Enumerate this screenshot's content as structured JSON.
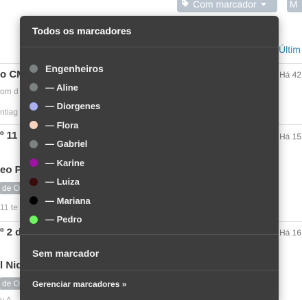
{
  "toolbar": {
    "filter_button_label": "Com marcador",
    "next_button_partial": "M"
  },
  "background": {
    "column_header": "Últim",
    "rows": [
      {
        "title": "o CM",
        "sub1": "om d",
        "sub2": "ntiag",
        "time": "Há 42"
      },
      {
        "title": "º 11",
        "time": "Há 15"
      },
      {
        "title": "eo P",
        "tag": "de O",
        "sub": "11 te"
      },
      {
        "title": "º 2 d",
        "time": "Há 16"
      },
      {
        "title": "l Niq",
        "tag": "de O",
        "sub": "y A"
      }
    ]
  },
  "dropdown": {
    "all_label": "Todos os marcadores",
    "group": {
      "label": "Engenheiros",
      "color": "#7b8382"
    },
    "items": [
      {
        "label": "— Aline",
        "color": "#7b8382"
      },
      {
        "label": "— Diorgenes",
        "color": "#aab0f2"
      },
      {
        "label": "— Flora",
        "color": "#f7d2bd"
      },
      {
        "label": "— Gabriel",
        "color": "#7b8382"
      },
      {
        "label": "— Karine",
        "color": "#a013a4"
      },
      {
        "label": "— Luiza",
        "color": "#3a0c0b"
      },
      {
        "label": "— Mariana",
        "color": "#000000"
      },
      {
        "label": "— Pedro",
        "color": "#6ef45e"
      }
    ],
    "none_label": "Sem marcador",
    "manage_label": "Gerenciar marcadores »"
  }
}
